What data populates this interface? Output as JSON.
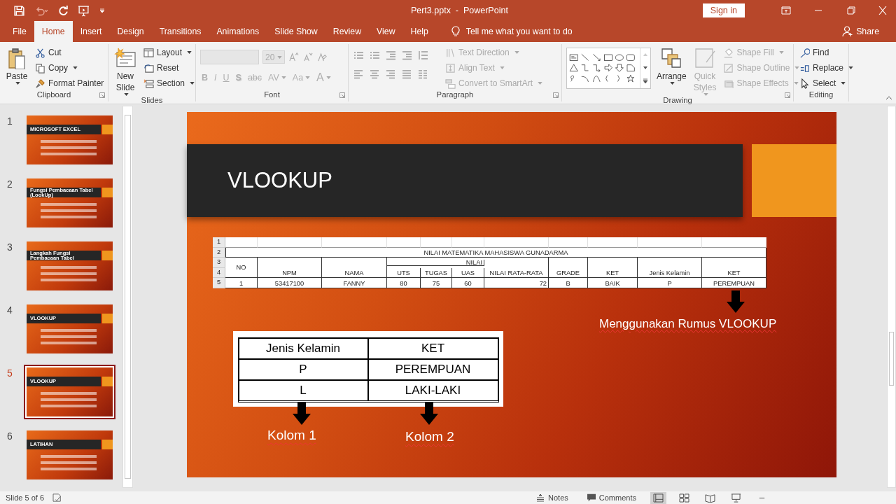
{
  "window": {
    "title": "Pert3.pptx  -  PowerPoint",
    "sign_in": "Sign in"
  },
  "tabs": [
    {
      "label": "File",
      "selected": false
    },
    {
      "label": "Home",
      "selected": true
    },
    {
      "label": "Insert",
      "selected": false
    },
    {
      "label": "Design",
      "selected": false
    },
    {
      "label": "Transitions",
      "selected": false
    },
    {
      "label": "Animations",
      "selected": false
    },
    {
      "label": "Slide Show",
      "selected": false
    },
    {
      "label": "Review",
      "selected": false
    },
    {
      "label": "View",
      "selected": false
    },
    {
      "label": "Help",
      "selected": false
    }
  ],
  "tell_me": "Tell me what you want to do",
  "share": "Share",
  "ribbon": [
    {
      "label": "Clipboard",
      "kind": "clipboard",
      "items": [
        {
          "label": "Paste",
          "kind": "large",
          "disabled": false,
          "dropdown": true
        },
        {
          "label": "Cut",
          "kind": "small",
          "disabled": false,
          "dropdown": false
        },
        {
          "label": "Copy",
          "kind": "small",
          "disabled": false,
          "dropdown": true
        },
        {
          "label": "Format Painter",
          "kind": "small",
          "disabled": false,
          "dropdown": false
        }
      ]
    },
    {
      "label": "Slides",
      "kind": "slides",
      "items": [
        {
          "label": "New Slide",
          "kind": "large",
          "disabled": false,
          "dropdown": true
        },
        {
          "label": "Layout",
          "kind": "small",
          "disabled": false,
          "dropdown": true
        },
        {
          "label": "Reset",
          "kind": "small",
          "disabled": false,
          "dropdown": false
        },
        {
          "label": "Section",
          "kind": "small",
          "disabled": false,
          "dropdown": true
        }
      ]
    },
    {
      "label": "Font",
      "kind": "font",
      "items": [
        {
          "label": "20",
          "kind": "field",
          "disabled": true,
          "dropdown": true
        },
        {
          "label": "B",
          "kind": "glyph",
          "disabled": true,
          "dropdown": false
        },
        {
          "label": "I",
          "kind": "glyph",
          "disabled": true,
          "dropdown": false
        },
        {
          "label": "U",
          "kind": "glyph",
          "disabled": true,
          "dropdown": false
        },
        {
          "label": "S",
          "kind": "glyph",
          "disabled": true,
          "dropdown": false
        },
        {
          "label": "abc",
          "kind": "glyph",
          "disabled": true,
          "dropdown": false
        },
        {
          "label": "AV",
          "kind": "glyph",
          "disabled": true,
          "dropdown": true
        },
        {
          "label": "Aa",
          "kind": "glyph",
          "disabled": true,
          "dropdown": true
        },
        {
          "label": "A",
          "kind": "glyph",
          "disabled": true,
          "dropdown": true
        }
      ]
    },
    {
      "label": "Paragraph",
      "kind": "paragraph",
      "items": [
        {
          "label": "Text Direction",
          "kind": "small",
          "disabled": true,
          "dropdown": true
        },
        {
          "label": "Align Text",
          "kind": "small",
          "disabled": true,
          "dropdown": true
        },
        {
          "label": "Convert to SmartArt",
          "kind": "small",
          "disabled": true,
          "dropdown": true
        }
      ]
    },
    {
      "label": "Drawing",
      "kind": "drawing",
      "items": [
        {
          "label": "Arrange",
          "kind": "large",
          "disabled": false,
          "dropdown": true
        },
        {
          "label": "Quick Styles",
          "kind": "large",
          "disabled": true,
          "dropdown": true
        },
        {
          "label": "Shape Fill",
          "kind": "small",
          "disabled": true,
          "dropdown": true
        },
        {
          "label": "Shape Outline",
          "kind": "small",
          "disabled": true,
          "dropdown": true
        },
        {
          "label": "Shape Effects",
          "kind": "small",
          "disabled": true,
          "dropdown": true
        }
      ]
    },
    {
      "label": "Editing",
      "kind": "editing",
      "items": [
        {
          "label": "Find",
          "kind": "small",
          "disabled": false,
          "dropdown": false
        },
        {
          "label": "Replace",
          "kind": "small",
          "disabled": false,
          "dropdown": true
        },
        {
          "label": "Select",
          "kind": "small",
          "disabled": false,
          "dropdown": true
        }
      ]
    }
  ],
  "slides": [
    {
      "number": "1",
      "title": "MICROSOFT EXCEL",
      "selected": false
    },
    {
      "number": "2",
      "title": "Fungsi Pembacaan Tabel (LookUp)",
      "selected": false
    },
    {
      "number": "3",
      "title": "Langkah Fungsi Pembacaan Tabel",
      "selected": false
    },
    {
      "number": "4",
      "title": "VLOOKUP",
      "selected": false
    },
    {
      "number": "5",
      "title": "VLOOKUP",
      "selected": true
    },
    {
      "number": "6",
      "title": "LATIHAN",
      "selected": false
    }
  ],
  "slide": {
    "title": "VLOOKUP",
    "sheet": {
      "row_headers": [
        "1",
        "2",
        "3",
        "4",
        "5"
      ],
      "title": "NILAI MATEMATIKA MAHASISWA GUNADARMA",
      "group_header": "NILAI",
      "columns": [
        "NO",
        "NPM",
        "NAMA",
        "UTS",
        "TUGAS",
        "UAS",
        "NILAI RATA-RATA",
        "GRADE",
        "KET",
        "Jenis Kelamin",
        "KET"
      ],
      "row": [
        "1",
        "53417100",
        "FANNY",
        "80",
        "75",
        "60",
        "72",
        "B",
        "BAIK",
        "P",
        "PEREMPUAN"
      ]
    },
    "caption": "Menggunakan Rumus VLOOKUP",
    "lookup_table": [
      [
        "Jenis Kelamin",
        "KET"
      ],
      [
        "P",
        "PEREMPUAN"
      ],
      [
        "L",
        "LAKI-LAKI"
      ]
    ],
    "column_labels": [
      "Kolom 1",
      "Kolom 2"
    ]
  },
  "status_bar": {
    "slide_info": "Slide 5 of 6",
    "notes": "Notes",
    "comments": "Comments"
  }
}
